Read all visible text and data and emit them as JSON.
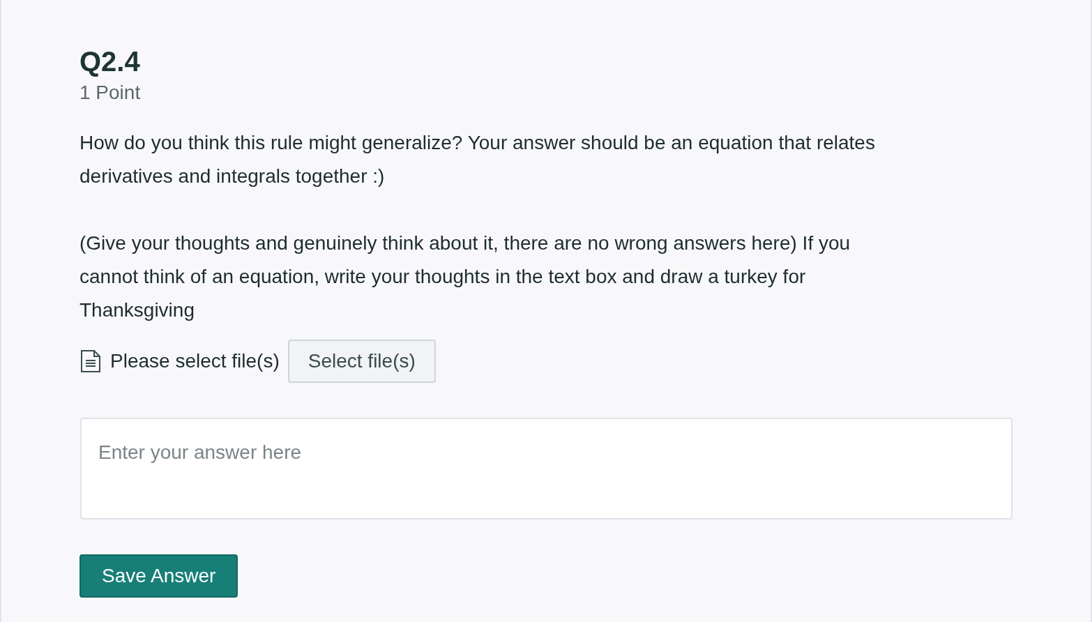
{
  "question": {
    "title": "Q2.4",
    "points": "1 Point",
    "paragraphs": [
      "How do you think this rule might generalize? Your answer should be an equation that relates derivatives and integrals together :)",
      "(Give your thoughts and genuinely think about it, there are no wrong answers here) If you cannot think of an equation, write your thoughts in the text box and draw a turkey for Thanksgiving"
    ]
  },
  "file_upload": {
    "status": "Please select file(s)",
    "button": "Select file(s)"
  },
  "answer": {
    "placeholder": "Enter your answer here"
  },
  "buttons": [
    "Save Answer"
  ]
}
